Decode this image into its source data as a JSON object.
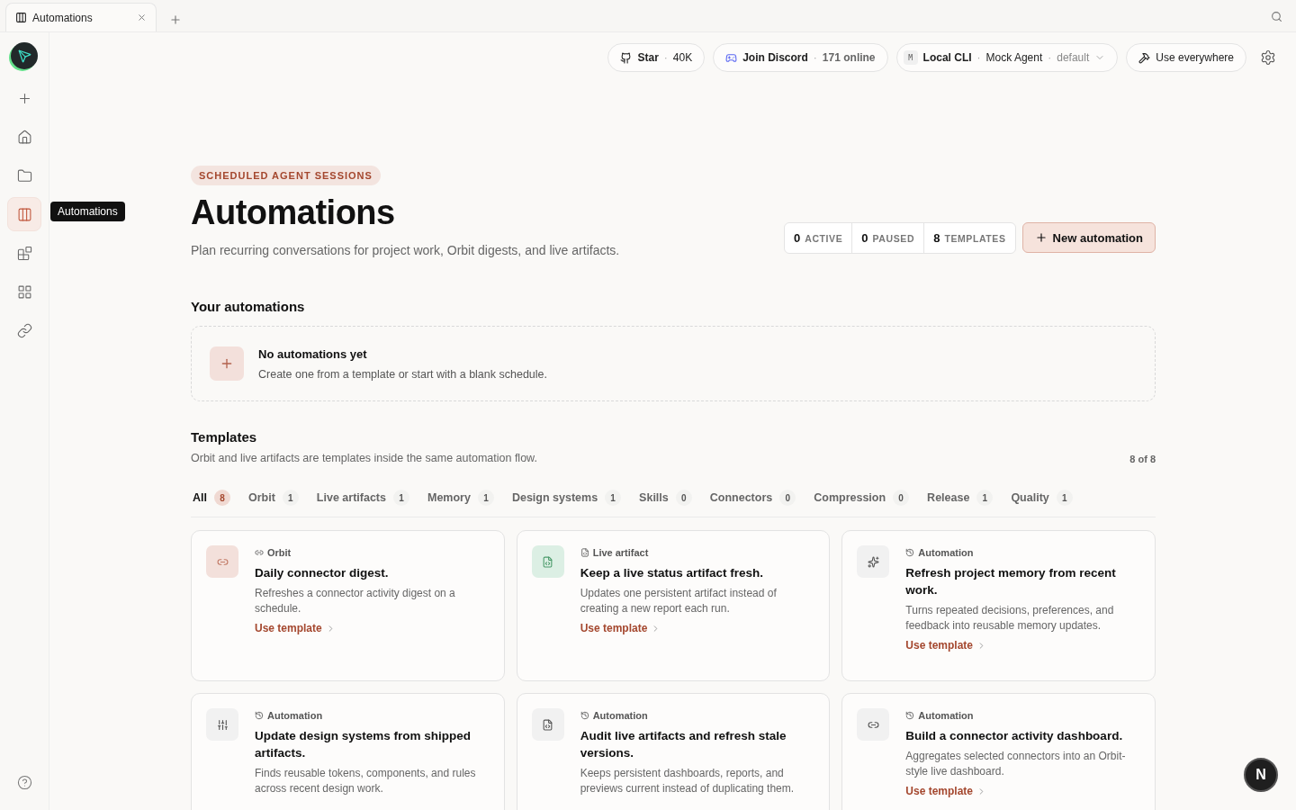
{
  "browser_tab": {
    "title": "Automations"
  },
  "sidebar": {
    "items": [
      {
        "kind": "new",
        "selected": false
      },
      {
        "kind": "home",
        "selected": false
      },
      {
        "kind": "projects",
        "selected": false
      },
      {
        "kind": "automations",
        "selected": true
      },
      {
        "kind": "plugins",
        "selected": false
      },
      {
        "kind": "apps",
        "selected": false
      },
      {
        "kind": "connectors",
        "selected": false
      }
    ],
    "tooltip": "Automations"
  },
  "topbar": {
    "separator": "·",
    "star": {
      "label": "Star",
      "count": "40K"
    },
    "discord": {
      "label": "Join Discord",
      "online": "171 online"
    },
    "agent": {
      "badge": "M",
      "source": "Local CLI",
      "name": "Mock Agent",
      "profile": "default"
    },
    "use_everywhere": "Use everywhere"
  },
  "header": {
    "eyebrow": "SCHEDULED AGENT SESSIONS",
    "title": "Automations",
    "subtitle": "Plan recurring conversations for project work, Orbit digests, and live artifacts.",
    "stats": [
      {
        "value": "0",
        "label": "ACTIVE"
      },
      {
        "value": "0",
        "label": "PAUSED"
      },
      {
        "value": "8",
        "label": "TEMPLATES"
      }
    ],
    "new_button": "New automation"
  },
  "your_automations": {
    "heading": "Your automations",
    "empty_title": "No automations yet",
    "empty_text": "Create one from a template or start with a blank schedule."
  },
  "templates": {
    "heading": "Templates",
    "description": "Orbit and live artifacts are templates inside the same automation flow.",
    "count": "8 of 8",
    "filters": [
      {
        "label": "All",
        "count": "8",
        "selected": true
      },
      {
        "label": "Orbit",
        "count": "1",
        "selected": false
      },
      {
        "label": "Live artifacts",
        "count": "1",
        "selected": false
      },
      {
        "label": "Memory",
        "count": "1",
        "selected": false
      },
      {
        "label": "Design systems",
        "count": "1",
        "selected": false
      },
      {
        "label": "Skills",
        "count": "0",
        "selected": false
      },
      {
        "label": "Connectors",
        "count": "0",
        "selected": false
      },
      {
        "label": "Compression",
        "count": "0",
        "selected": false
      },
      {
        "label": "Release",
        "count": "1",
        "selected": false
      },
      {
        "label": "Quality",
        "count": "1",
        "selected": false
      }
    ],
    "cards": [
      {
        "kind": "orbit",
        "category": "Orbit",
        "title": "Daily connector digest.",
        "text": "Refreshes a connector activity digest on a schedule.",
        "link": "Use template"
      },
      {
        "kind": "live",
        "category": "Live artifact",
        "title": "Keep a live status artifact fresh.",
        "text": "Updates one persistent artifact instead of creating a new report each run.",
        "link": "Use template"
      },
      {
        "kind": "automation",
        "category": "Automation",
        "title": "Refresh project memory from recent work.",
        "text": "Turns repeated decisions, preferences, and feedback into reusable memory updates.",
        "link": "Use template"
      },
      {
        "kind": "automation",
        "category": "Automation",
        "title": "Update design systems from shipped artifacts.",
        "text": "Finds reusable tokens, components, and rules across recent design work."
      },
      {
        "kind": "automation",
        "category": "Automation",
        "title": "Audit live artifacts and refresh stale versions.",
        "text": "Keeps persistent dashboards, reports, and previews current instead of duplicating them."
      },
      {
        "kind": "automation",
        "category": "Automation",
        "title": "Build a connector activity dashboard.",
        "text": "Aggregates selected connectors into an Orbit-style live dashboard.",
        "link": "Use template"
      }
    ]
  },
  "corner_badge": "N"
}
